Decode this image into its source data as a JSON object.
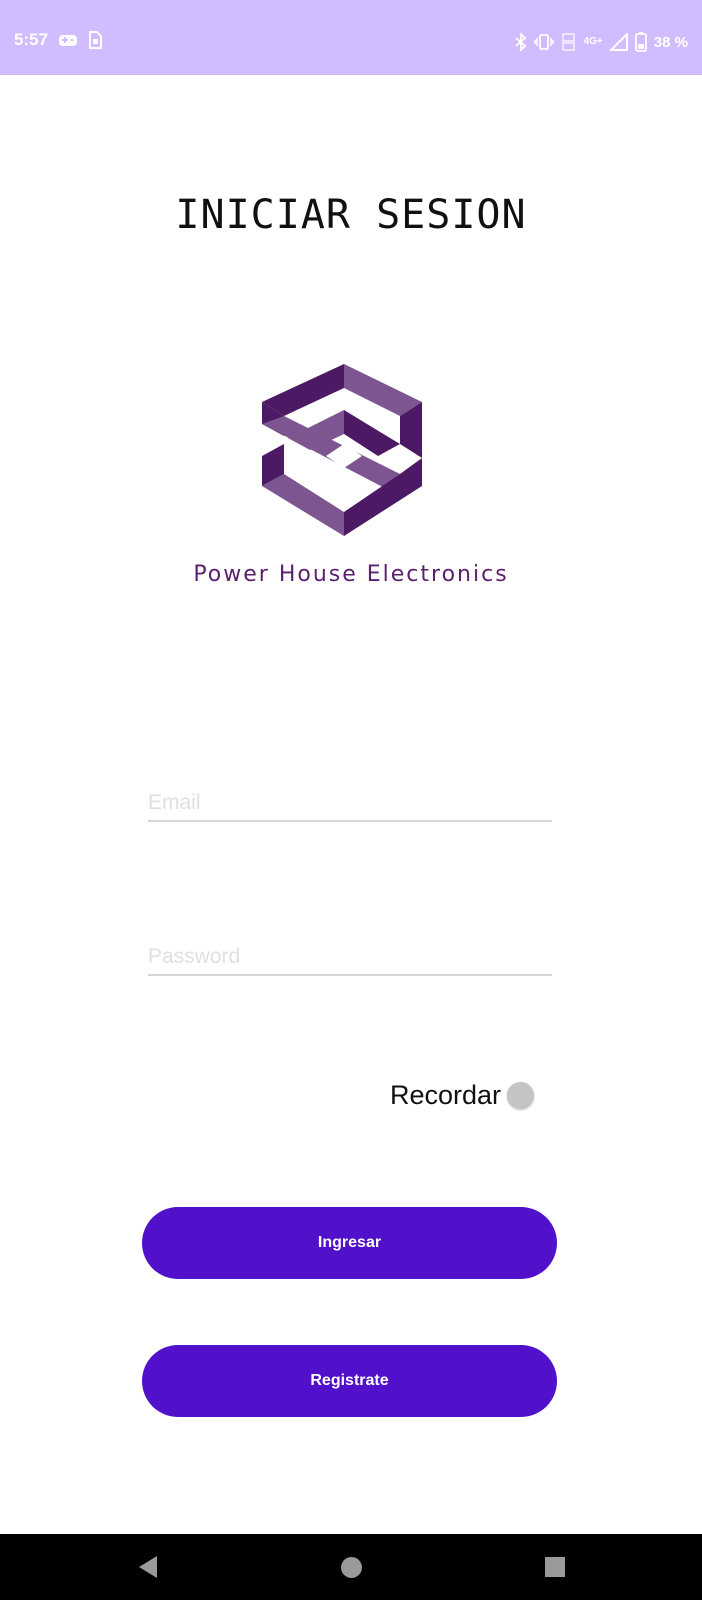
{
  "status_bar": {
    "time": "5:57",
    "battery": "38 %",
    "network": "4G+",
    "icons": [
      "gamepad-icon",
      "sim-icon",
      "bluetooth-icon",
      "vibrate-icon",
      "volte-icon",
      "signal-icon",
      "battery-icon"
    ]
  },
  "login": {
    "title": "INICIAR SESION",
    "brand": "Power House Electronics",
    "email_placeholder": "Email",
    "password_placeholder": "Password",
    "remember_label": "Recordar",
    "remember_on": false,
    "login_button": "Ingresar",
    "register_button": "Registrate"
  },
  "colors": {
    "status_bar": "#d1bcff",
    "accent": "#5110c9",
    "logo_dark": "#4c1a64",
    "logo_light": "#7d5590"
  },
  "nav_bar": {
    "buttons": [
      "back-icon",
      "home-icon",
      "recents-icon"
    ]
  }
}
